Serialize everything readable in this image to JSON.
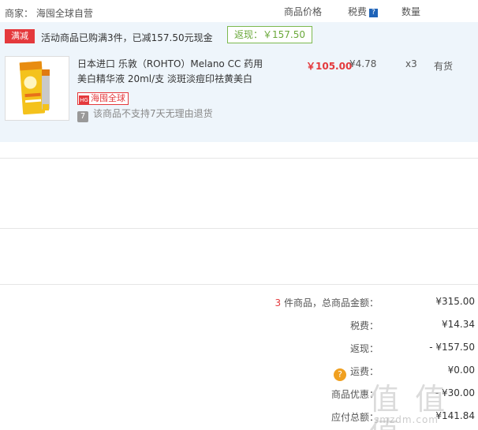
{
  "header": {
    "merchant_label": "商家：",
    "merchant_name": "海囤全球自营",
    "col_price": "商品价格",
    "col_tax": "税费",
    "tax_help_icon": "question-icon",
    "col_qty": "数量"
  },
  "promo": {
    "tag": "满减",
    "text": "活动商品已购满3件，已减157.50元现金",
    "rebate": "返现：￥157.50"
  },
  "item": {
    "title": "日本进口 乐敦（ROHTO）Melano CC 药用美白精华液 20ml/支 淡斑淡痘印祛黄美白",
    "badge": "海囤全球",
    "return_policy": "该商品不支持7天无理由退货",
    "price": "￥105.00",
    "tax": "¥4.78",
    "qty": "x3",
    "stock": "有货"
  },
  "summary": {
    "count": "3",
    "total_label": " 件商品，总商品金额：",
    "total_value": "¥315.00",
    "tax_label": "税费：",
    "tax_value": "¥14.34",
    "rebate_label": "返现：",
    "rebate_value": "- ¥157.50",
    "shipping_label": "运费：",
    "shipping_value": "¥0.00",
    "discount_label": "商品优惠：",
    "discount_value": "- ¥30.00",
    "due_label": "应付总额：",
    "due_value": "¥141.84"
  },
  "watermark": {
    "big": "值 值 值",
    "small": "smzdm.com"
  },
  "colors": {
    "accent_red": "#e4393c",
    "rebate_green": "#6aa83a",
    "row_bg": "#eef5fb"
  }
}
